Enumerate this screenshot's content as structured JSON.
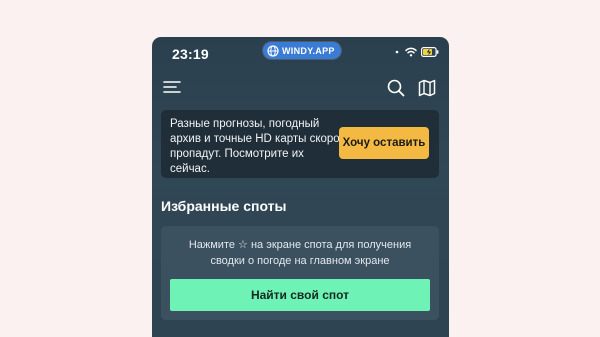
{
  "status_bar": {
    "time": "23:19",
    "app_badge": "WINDY.APP",
    "icons": [
      "signal-dots-icon",
      "wifi-icon",
      "battery-charging-icon"
    ]
  },
  "top_bar": {
    "icons": [
      "menu-icon",
      "search-icon",
      "map-icon"
    ]
  },
  "banner": {
    "text": "Разные прогнозы, погодный архив и точные HD карты скоро пропадут. Посмотрите их сейчас.",
    "button_label": "Хочу оставить"
  },
  "favorites": {
    "title": "Избранные споты",
    "hint": "Нажмите ☆ на экране спота для получения сводки о погоде на главном экране",
    "button_label": "Найти свой спот"
  },
  "colors": {
    "page_background": "#fcf1f1",
    "app_background": "#2f4452",
    "banner_background": "#1f2e38",
    "banner_button": "#f4b942",
    "card_background": "#3b5160",
    "primary_button": "#6ff2b6",
    "badge": "#3a7bd5"
  }
}
